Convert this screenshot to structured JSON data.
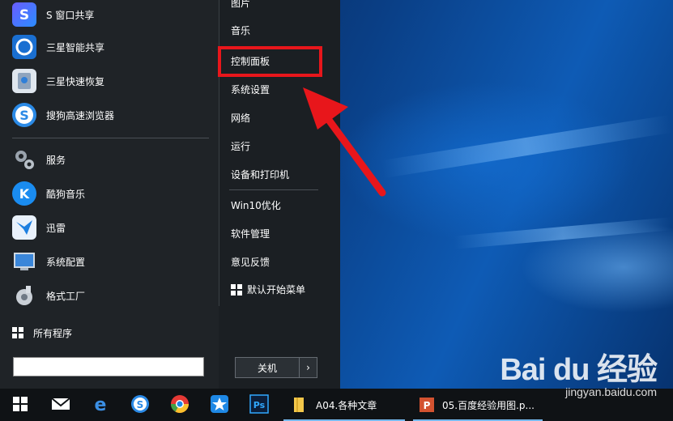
{
  "start_menu": {
    "pinned_apps": [
      {
        "label": "S 窗口共享",
        "icon": "s-window-share-icon"
      },
      {
        "label": "三星智能共享",
        "icon": "samsung-smart-share-icon"
      },
      {
        "label": "三星快速恢复",
        "icon": "samsung-recovery-icon"
      },
      {
        "label": "搜狗高速浏览器",
        "icon": "sogou-browser-icon"
      }
    ],
    "apps": [
      {
        "label": "服务",
        "icon": "gears-icon"
      },
      {
        "label": "酷狗音乐",
        "icon": "kugou-music-icon"
      },
      {
        "label": "迅雷",
        "icon": "xunlei-icon"
      },
      {
        "label": "系统配置",
        "icon": "system-config-icon"
      },
      {
        "label": "格式工厂",
        "icon": "format-factory-icon"
      }
    ],
    "all_programs": "所有程序",
    "search_value": "",
    "right_items_group1": [
      "图片",
      "音乐",
      "控制面板",
      "系统设置",
      "网络",
      "运行",
      "设备和打印机"
    ],
    "right_items_group2": [
      "Win10优化",
      "软件管理",
      "意见反馈"
    ],
    "default_start_menu": "默认开始菜单",
    "shutdown_label": "关机",
    "shutdown_more": "›"
  },
  "taskbar": {
    "tasks": [
      {
        "label": "A04.各种文章",
        "icon": "folder-icon"
      },
      {
        "label": "05.百度经验用图.p...",
        "icon": "powerpoint-icon"
      }
    ]
  },
  "watermark": {
    "logo": "Bai du 经验",
    "url": "jingyan.baidu.com"
  },
  "colors": {
    "highlight": "#e8161b",
    "arrow": "#e8161b",
    "menu_bg": "#1f2327"
  }
}
